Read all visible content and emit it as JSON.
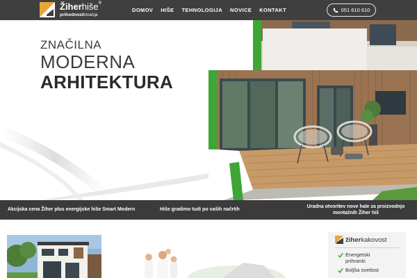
{
  "header": {
    "logo": {
      "brand_bold": "Žiher",
      "brand_thin": "hiše",
      "registered": "®",
      "tagline_bold": "prihodnost",
      "tagline_rest": "bivanja"
    },
    "nav": [
      {
        "label": "DOMOV"
      },
      {
        "label": "HIŠE"
      },
      {
        "label": "TEHNOLOGIJA"
      },
      {
        "label": "NOVICE"
      },
      {
        "label": "KONTAKT"
      }
    ],
    "phone": {
      "number": "051 610 610",
      "icon": "phone-icon"
    }
  },
  "hero": {
    "line1": "ZNAČILNA",
    "line2": "MODERNA",
    "line3": "ARHITEKTURA",
    "accent_color": "#3fa535"
  },
  "strip": {
    "items": [
      {
        "text": "Akcijska cena Žiher plus energijske hiše Smart Modern"
      },
      {
        "text": "Hiše gradimo tudi po vaših načrtih"
      },
      {
        "line1": "Uradna otvoritev nove hale za proizvodnjo",
        "line2": "montažnih Žiher hiš"
      }
    ]
  },
  "quality": {
    "brand_bold": "žiher",
    "brand_rest": "kakovost",
    "items": [
      {
        "line1": "Energetski",
        "line2": "prihranki"
      },
      {
        "line1": "Boljša svetlost",
        "line2": ""
      }
    ],
    "check_color": "#3fa535"
  },
  "colors": {
    "header_bg": "#3f3f3f",
    "strip_bg": "#3b3b3b",
    "accent": "#3fa535"
  }
}
